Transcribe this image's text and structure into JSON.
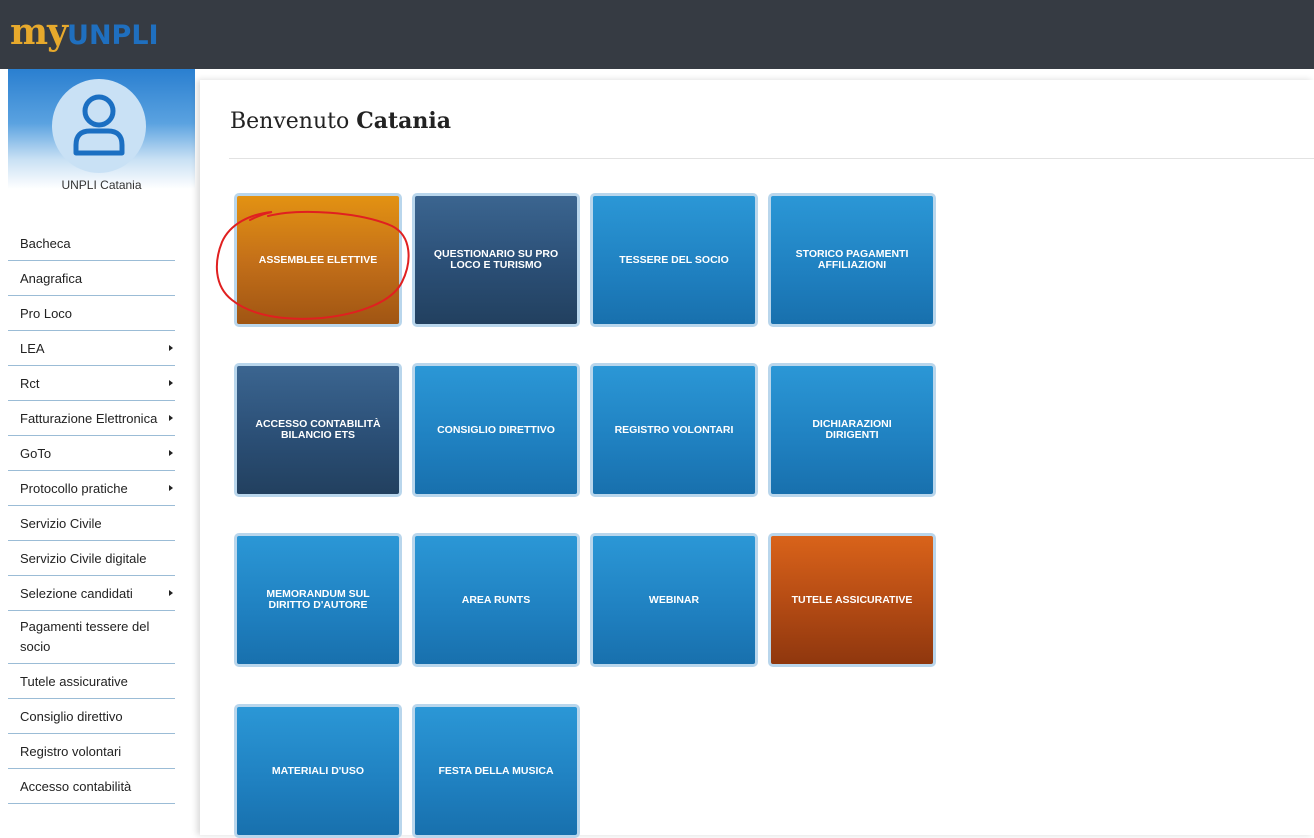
{
  "logo": {
    "my": "my",
    "unpli": "UNPLI"
  },
  "profile": {
    "name": "UNPLI Catania"
  },
  "menu": [
    {
      "label": "Bacheca",
      "has_submenu": false
    },
    {
      "label": "Anagrafica",
      "has_submenu": false
    },
    {
      "label": "Pro Loco",
      "has_submenu": false
    },
    {
      "label": "LEA",
      "has_submenu": true
    },
    {
      "label": "Rct",
      "has_submenu": true
    },
    {
      "label": "Fatturazione Elettronica",
      "has_submenu": true
    },
    {
      "label": "GoTo",
      "has_submenu": true
    },
    {
      "label": "Protocollo pratiche",
      "has_submenu": true
    },
    {
      "label": "Servizio Civile",
      "has_submenu": false
    },
    {
      "label": "Servizio Civile digitale",
      "has_submenu": false
    },
    {
      "label": "Selezione candidati",
      "has_submenu": true
    },
    {
      "label": "Pagamenti tessere del socio",
      "has_submenu": false
    },
    {
      "label": "Tutele assicurative",
      "has_submenu": false
    },
    {
      "label": "Consiglio direttivo",
      "has_submenu": false
    },
    {
      "label": "Registro volontari",
      "has_submenu": false
    },
    {
      "label": "Accesso contabilità",
      "has_submenu": false
    }
  ],
  "welcome": {
    "prefix": "Benvenuto",
    "name": "Catania"
  },
  "tiles": [
    {
      "label": "Assemblee elettive",
      "color": "orange"
    },
    {
      "label": "Questionario su Pro Loco e Turismo",
      "color": "dark"
    },
    {
      "label": "Tessere del socio",
      "color": "blue"
    },
    {
      "label": "Storico pagamenti affiliazioni",
      "color": "blue"
    },
    {
      "label": "Accesso contabilità bilancio ETS",
      "color": "dark"
    },
    {
      "label": "Consiglio direttivo",
      "color": "blue"
    },
    {
      "label": "Registro volontari",
      "color": "blue"
    },
    {
      "label": "Dichiarazioni dirigenti",
      "color": "blue"
    },
    {
      "label": "Memorandum sul diritto d'autore",
      "color": "blue"
    },
    {
      "label": "Area RUNTS",
      "color": "blue"
    },
    {
      "label": "Webinar",
      "color": "blue"
    },
    {
      "label": "Tutele assicurative",
      "color": "rust"
    },
    {
      "label": "Materiali d'uso",
      "color": "blue"
    },
    {
      "label": "Festa della musica",
      "color": "blue"
    }
  ],
  "colors": {
    "topbar": "#363b43",
    "logo_my": "#e7a92c",
    "logo_unpli": "#1f6fbf",
    "tile_blue": "#1f80c0",
    "tile_dark": "#2b4f76",
    "tile_orange": "#c47019",
    "tile_rust": "#b64c14",
    "annotation": "#e02020"
  }
}
